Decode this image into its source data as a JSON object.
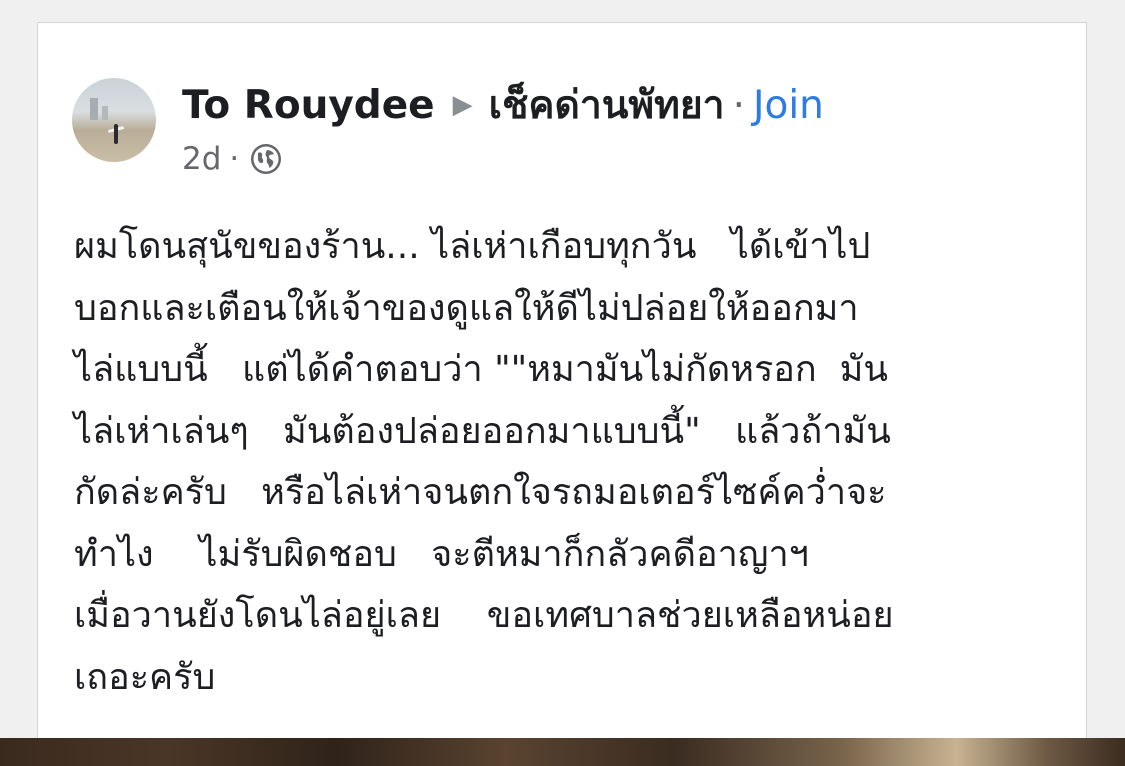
{
  "post": {
    "author": "To Rouydee",
    "group": "เช็คด่านพัทยา",
    "separator": "·",
    "join_label": "Join",
    "time": "2d",
    "time_separator": "·",
    "privacy_icon": "globe-icon",
    "arrow_icon": "▶",
    "body_lines": [
      "ผมโดนสุนัขของร้าน... ไล่เห่าเกือบทุกวัน   ได้เข้าไป",
      "บอกและเตือนให้เจ้าของดูแลให้ดีไม่ปล่อยให้ออกมา",
      "ไล่แบบนี้   แต่ได้คำตอบว่า \"\"หมามันไม่กัดหรอก  มัน",
      "ไล่เห่าเล่นๆ   มันต้องปล่อยออกมาแบบนี้\"   แล้วถ้ามัน",
      "กัดล่ะครับ   หรือไล่เห่าจนตกใจรถมอเตอร์ไซค์คว่ำจะ",
      "ทำไง    ไม่รับผิดชอบ   จะตีหมาก็กลัวคดีอาญาฯ",
      "เมื่อวานยังโดนไล่อยู่เลย    ขอเทศบาลช่วยเหลือหน่อย",
      "เถอะครับ"
    ]
  },
  "colors": {
    "join": "#2d7be5",
    "text": "#1c1e21",
    "meta": "#65676b"
  }
}
